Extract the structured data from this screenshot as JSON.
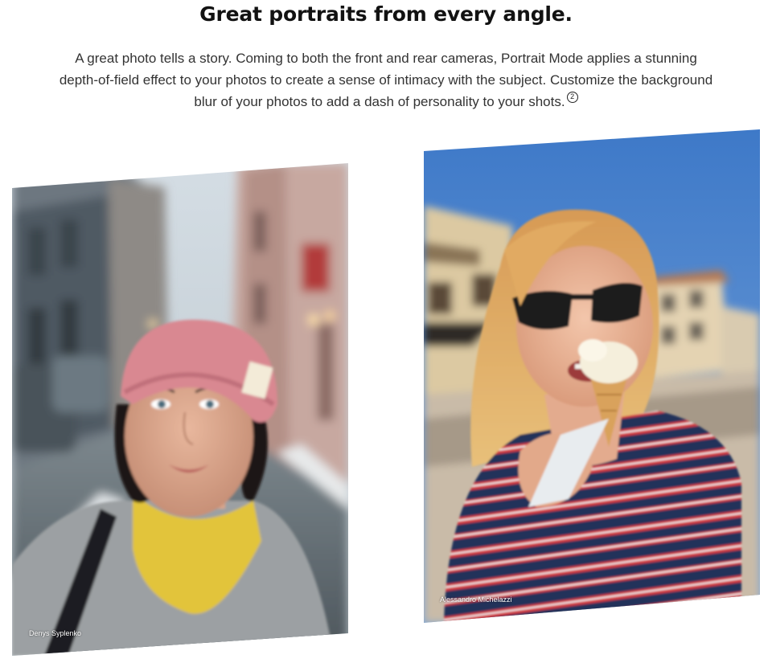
{
  "section": {
    "title": "Great portraits from every angle.",
    "description": "A great photo tells a story. Coming to both the front and rear cameras, Portrait Mode applies a stunning depth-of-field effect to your photos to create a sense of intimacy with the subject. Customize the background blur of your photos to add a dash of personality to your shots.",
    "footnote": "2"
  },
  "photos": [
    {
      "credit": "Denys Syplenko",
      "subject": "woman in pink knit beanie and yellow turtleneck on a city street"
    },
    {
      "credit": "Alessandro Michelazzi",
      "subject": "woman in sunglasses eating an ice cream cone in the sun"
    }
  ],
  "colors": {
    "title": "#121212",
    "body_text": "#333333",
    "background": "#ffffff"
  }
}
